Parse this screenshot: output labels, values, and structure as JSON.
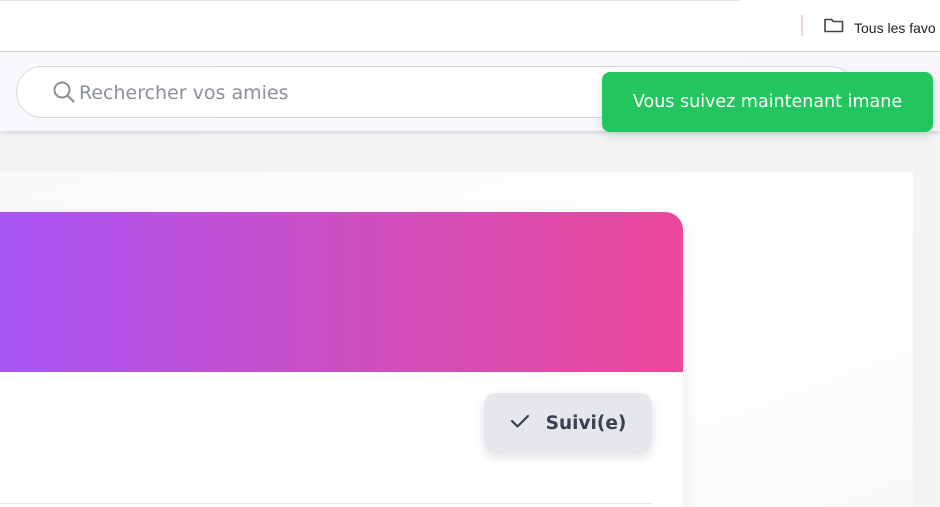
{
  "browser": {
    "bookmarks_bar": {
      "all_bookmarks_label": "Tous les favo",
      "folder_icon": "folder-icon"
    }
  },
  "header": {
    "search": {
      "placeholder": "Rechercher vos amies",
      "value": "",
      "icon": "search-icon"
    }
  },
  "toast": {
    "message": "Vous suivez maintenant imane",
    "color": "#22c55e"
  },
  "profile_card": {
    "cover_gradient": [
      "#a855f7",
      "#ec4899"
    ],
    "follow_button": {
      "label": "Suivi(e)",
      "icon": "checkmark-icon",
      "state": "following"
    }
  }
}
